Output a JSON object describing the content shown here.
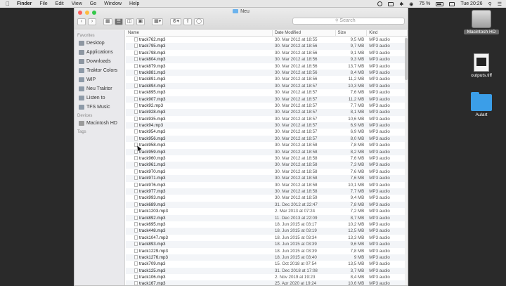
{
  "menubar": {
    "app": "Finder",
    "items": [
      "File",
      "Edit",
      "View",
      "Go",
      "Window",
      "Help"
    ],
    "battery": "75 %",
    "clock": "Tue 20:26"
  },
  "window": {
    "title": "Neu",
    "search_placeholder": "Search",
    "toolbar": {
      "back": "‹",
      "forward": "›"
    }
  },
  "sidebar": {
    "favorites_title": "Favorites",
    "favorites": [
      "Desktop",
      "Applications",
      "Downloads",
      "Traktor Colors",
      "WIP",
      "Neu Traktor",
      "Listen to",
      "TFS Music"
    ],
    "devices_title": "Devices",
    "devices": [
      "Macintosh HD"
    ],
    "tags_title": "Tags"
  },
  "columns": {
    "name": "Name",
    "date": "Date Modified",
    "size": "Size",
    "kind": "Kind"
  },
  "files": [
    [
      "track762.mp3",
      "30. Mar 2012 at 18:55",
      "9,5 MB",
      "MP3 audio"
    ],
    [
      "track795.mp3",
      "30. Mar 2012 at 18:56",
      "9,7 MB",
      "MP3 audio"
    ],
    [
      "track798.mp3",
      "30. Mar 2012 at 18:56",
      "9,1 MB",
      "MP3 audio"
    ],
    [
      "track804.mp3",
      "30. Mar 2012 at 18:56",
      "9,3 MB",
      "MP3 audio"
    ],
    [
      "track879.mp3",
      "30. Mar 2012 at 18:56",
      "13,7 MB",
      "MP3 audio"
    ],
    [
      "track881.mp3",
      "30. Mar 2012 at 18:56",
      "8,4 MB",
      "MP3 audio"
    ],
    [
      "track891.mp3",
      "30. Mar 2012 at 18:56",
      "11,2 MB",
      "MP3 audio"
    ],
    [
      "track894.mp3",
      "30. Mar 2012 at 18:57",
      "10,3 MB",
      "MP3 audio"
    ],
    [
      "track895.mp3",
      "30. Mar 2012 at 18:57",
      "7,6 MB",
      "MP3 audio"
    ],
    [
      "track907.mp3",
      "30. Mar 2012 at 18:57",
      "11,2 MB",
      "MP3 audio"
    ],
    [
      "track92.mp3",
      "30. Mar 2012 at 18:57",
      "7,7 MB",
      "MP3 audio"
    ],
    [
      "track928.mp3",
      "30. Mar 2012 at 18:57",
      "8,1 MB",
      "MP3 audio"
    ],
    [
      "track935.mp3",
      "30. Mar 2012 at 18:57",
      "10,6 MB",
      "MP3 audio"
    ],
    [
      "track94.mp3",
      "30. Mar 2012 at 18:57",
      "6,9 MB",
      "MP3 audio"
    ],
    [
      "track954.mp3",
      "30. Mar 2012 at 18:57",
      "6,9 MB",
      "MP3 audio"
    ],
    [
      "track956.mp3",
      "30. Mar 2012 at 18:57",
      "8,0 MB",
      "MP3 audio"
    ],
    [
      "track958.mp3",
      "30. Mar 2012 at 18:58",
      "7,8 MB",
      "MP3 audio"
    ],
    [
      "track959.mp3",
      "30. Mar 2012 at 18:58",
      "8,2 MB",
      "MP3 audio"
    ],
    [
      "track960.mp3",
      "30. Mar 2012 at 18:58",
      "7,6 MB",
      "MP3 audio"
    ],
    [
      "track961.mp3",
      "30. Mar 2012 at 18:58",
      "7,3 MB",
      "MP3 audio"
    ],
    [
      "track970.mp3",
      "30. Mar 2012 at 18:58",
      "7,6 MB",
      "MP3 audio"
    ],
    [
      "track971.mp3",
      "30. Mar 2012 at 18:58",
      "7,6 MB",
      "MP3 audio"
    ],
    [
      "track976.mp3",
      "30. Mar 2012 at 18:58",
      "10,1 MB",
      "MP3 audio"
    ],
    [
      "track977.mp3",
      "30. Mar 2012 at 18:58",
      "7,7 MB",
      "MP3 audio"
    ],
    [
      "track993.mp3",
      "30. Mar 2012 at 18:59",
      "9,4 MB",
      "MP3 audio"
    ],
    [
      "track689.mp3",
      "31. Dec 2012 at 22:47",
      "7,8 MB",
      "MP3 audio"
    ],
    [
      "track1203.mp3",
      "2. Mar 2013 at 07:24",
      "7,2 MB",
      "MP3 audio"
    ],
    [
      "track892.mp3",
      "11. Dec 2013 at 22:09",
      "8,7 MB",
      "MP3 audio"
    ],
    [
      "track695.mp3",
      "18. Jun 2015 at 03:17",
      "10,2 MB",
      "MP3 audio"
    ],
    [
      "track448.mp3",
      "18. Jun 2015 at 03:19",
      "12,5 MB",
      "MP3 audio"
    ],
    [
      "track1047.mp3",
      "18. Jun 2015 at 03:34",
      "13,3 MB",
      "MP3 audio"
    ],
    [
      "track893.mp3",
      "18. Jun 2015 at 03:39",
      "9,6 MB",
      "MP3 audio"
    ],
    [
      "track1229.mp3",
      "18. Jun 2015 at 03:39",
      "7,8 MB",
      "MP3 audio"
    ],
    [
      "track1276.mp3",
      "18. Jun 2015 at 03:40",
      "9 MB",
      "MP3 audio"
    ],
    [
      "track709.mp3",
      "15. Oct 2018 at 07:54",
      "13,5 MB",
      "MP3 audio"
    ],
    [
      "track125.mp3",
      "31. Dec 2018 at 17:08",
      "3,7 MB",
      "MP3 audio"
    ],
    [
      "track106.mp3",
      "2. Nov 2019 at 19:23",
      "8,4 MB",
      "MP3 audio"
    ],
    [
      "track167.mp3",
      "25. Apr 2020 at 19:24",
      "10,6 MB",
      "MP3 audio"
    ]
  ],
  "desktop": [
    {
      "label": "Macintosh HD",
      "icon": "hard-drive-icon"
    },
    {
      "label": "outputs.tiff",
      "icon": "tiff-file-icon"
    },
    {
      "label": "Aulart",
      "icon": "folder-icon"
    }
  ]
}
